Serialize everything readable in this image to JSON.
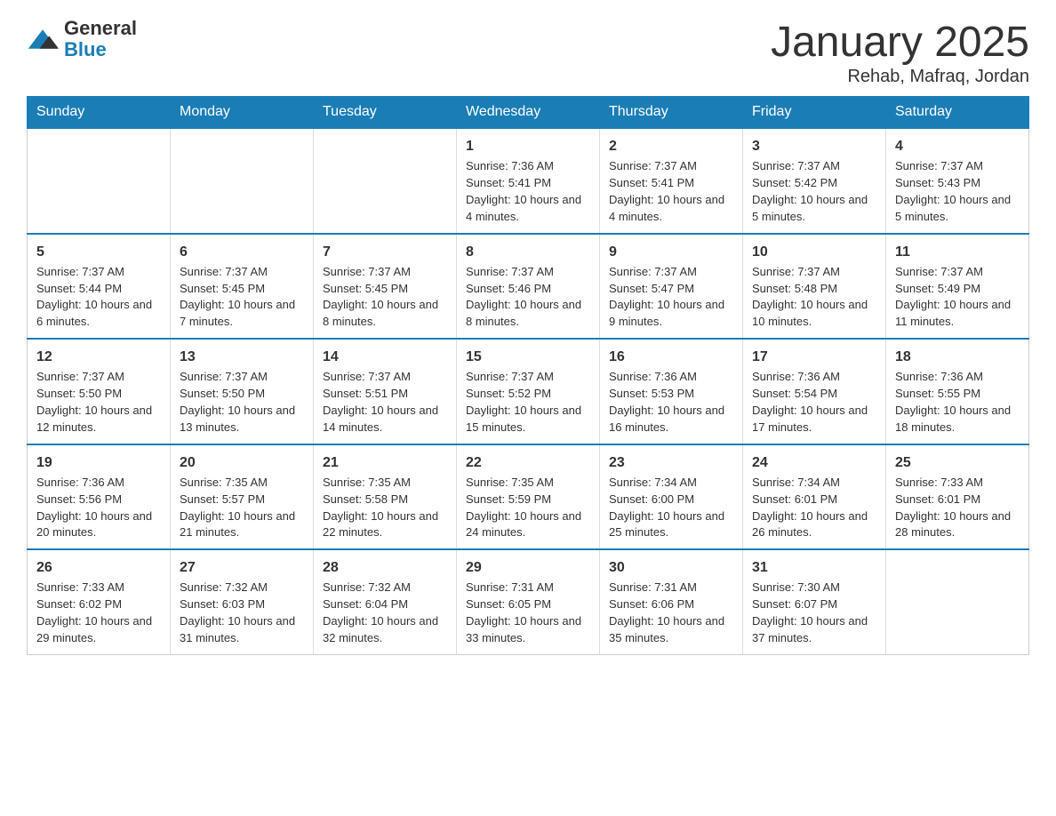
{
  "header": {
    "logo_line1": "General",
    "logo_line2": "Blue",
    "month_title": "January 2025",
    "location": "Rehab, Mafraq, Jordan"
  },
  "days_of_week": [
    "Sunday",
    "Monday",
    "Tuesday",
    "Wednesday",
    "Thursday",
    "Friday",
    "Saturday"
  ],
  "weeks": [
    [
      {
        "day": "",
        "info": ""
      },
      {
        "day": "",
        "info": ""
      },
      {
        "day": "",
        "info": ""
      },
      {
        "day": "1",
        "info": "Sunrise: 7:36 AM\nSunset: 5:41 PM\nDaylight: 10 hours and 4 minutes."
      },
      {
        "day": "2",
        "info": "Sunrise: 7:37 AM\nSunset: 5:41 PM\nDaylight: 10 hours and 4 minutes."
      },
      {
        "day": "3",
        "info": "Sunrise: 7:37 AM\nSunset: 5:42 PM\nDaylight: 10 hours and 5 minutes."
      },
      {
        "day": "4",
        "info": "Sunrise: 7:37 AM\nSunset: 5:43 PM\nDaylight: 10 hours and 5 minutes."
      }
    ],
    [
      {
        "day": "5",
        "info": "Sunrise: 7:37 AM\nSunset: 5:44 PM\nDaylight: 10 hours and 6 minutes."
      },
      {
        "day": "6",
        "info": "Sunrise: 7:37 AM\nSunset: 5:45 PM\nDaylight: 10 hours and 7 minutes."
      },
      {
        "day": "7",
        "info": "Sunrise: 7:37 AM\nSunset: 5:45 PM\nDaylight: 10 hours and 8 minutes."
      },
      {
        "day": "8",
        "info": "Sunrise: 7:37 AM\nSunset: 5:46 PM\nDaylight: 10 hours and 8 minutes."
      },
      {
        "day": "9",
        "info": "Sunrise: 7:37 AM\nSunset: 5:47 PM\nDaylight: 10 hours and 9 minutes."
      },
      {
        "day": "10",
        "info": "Sunrise: 7:37 AM\nSunset: 5:48 PM\nDaylight: 10 hours and 10 minutes."
      },
      {
        "day": "11",
        "info": "Sunrise: 7:37 AM\nSunset: 5:49 PM\nDaylight: 10 hours and 11 minutes."
      }
    ],
    [
      {
        "day": "12",
        "info": "Sunrise: 7:37 AM\nSunset: 5:50 PM\nDaylight: 10 hours and 12 minutes."
      },
      {
        "day": "13",
        "info": "Sunrise: 7:37 AM\nSunset: 5:50 PM\nDaylight: 10 hours and 13 minutes."
      },
      {
        "day": "14",
        "info": "Sunrise: 7:37 AM\nSunset: 5:51 PM\nDaylight: 10 hours and 14 minutes."
      },
      {
        "day": "15",
        "info": "Sunrise: 7:37 AM\nSunset: 5:52 PM\nDaylight: 10 hours and 15 minutes."
      },
      {
        "day": "16",
        "info": "Sunrise: 7:36 AM\nSunset: 5:53 PM\nDaylight: 10 hours and 16 minutes."
      },
      {
        "day": "17",
        "info": "Sunrise: 7:36 AM\nSunset: 5:54 PM\nDaylight: 10 hours and 17 minutes."
      },
      {
        "day": "18",
        "info": "Sunrise: 7:36 AM\nSunset: 5:55 PM\nDaylight: 10 hours and 18 minutes."
      }
    ],
    [
      {
        "day": "19",
        "info": "Sunrise: 7:36 AM\nSunset: 5:56 PM\nDaylight: 10 hours and 20 minutes."
      },
      {
        "day": "20",
        "info": "Sunrise: 7:35 AM\nSunset: 5:57 PM\nDaylight: 10 hours and 21 minutes."
      },
      {
        "day": "21",
        "info": "Sunrise: 7:35 AM\nSunset: 5:58 PM\nDaylight: 10 hours and 22 minutes."
      },
      {
        "day": "22",
        "info": "Sunrise: 7:35 AM\nSunset: 5:59 PM\nDaylight: 10 hours and 24 minutes."
      },
      {
        "day": "23",
        "info": "Sunrise: 7:34 AM\nSunset: 6:00 PM\nDaylight: 10 hours and 25 minutes."
      },
      {
        "day": "24",
        "info": "Sunrise: 7:34 AM\nSunset: 6:01 PM\nDaylight: 10 hours and 26 minutes."
      },
      {
        "day": "25",
        "info": "Sunrise: 7:33 AM\nSunset: 6:01 PM\nDaylight: 10 hours and 28 minutes."
      }
    ],
    [
      {
        "day": "26",
        "info": "Sunrise: 7:33 AM\nSunset: 6:02 PM\nDaylight: 10 hours and 29 minutes."
      },
      {
        "day": "27",
        "info": "Sunrise: 7:32 AM\nSunset: 6:03 PM\nDaylight: 10 hours and 31 minutes."
      },
      {
        "day": "28",
        "info": "Sunrise: 7:32 AM\nSunset: 6:04 PM\nDaylight: 10 hours and 32 minutes."
      },
      {
        "day": "29",
        "info": "Sunrise: 7:31 AM\nSunset: 6:05 PM\nDaylight: 10 hours and 33 minutes."
      },
      {
        "day": "30",
        "info": "Sunrise: 7:31 AM\nSunset: 6:06 PM\nDaylight: 10 hours and 35 minutes."
      },
      {
        "day": "31",
        "info": "Sunrise: 7:30 AM\nSunset: 6:07 PM\nDaylight: 10 hours and 37 minutes."
      },
      {
        "day": "",
        "info": ""
      }
    ]
  ]
}
